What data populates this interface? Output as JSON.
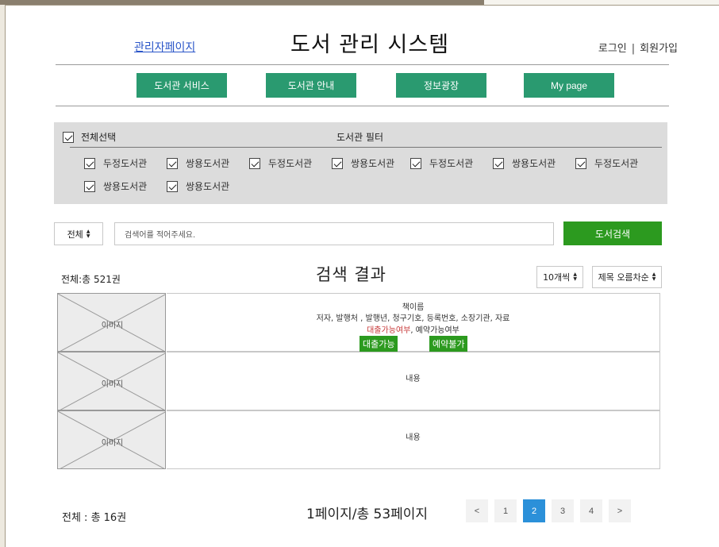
{
  "header": {
    "admin_link": "관리자페이지",
    "title": "도서 관리 시스템",
    "login": "로그인",
    "separator": "|",
    "signup": "회원가입"
  },
  "nav": [
    "도서관 서비스",
    "도서관 안내",
    "정보광장",
    "My page"
  ],
  "filter": {
    "select_all": "전체선택",
    "title": "도서관 필터",
    "libraries": [
      "두정도서관",
      "쌍용도서관",
      "두정도서관",
      "쌍용도서관",
      "두정도서관",
      "쌍용도서관",
      "두정도서관",
      "쌍용도서관",
      "쌍용도서관"
    ]
  },
  "search": {
    "category": "전체",
    "placeholder": "검색어를 적어주세요.",
    "button": "도서검색"
  },
  "results_header": {
    "total": "전체:총 521권",
    "title": "검색 결과",
    "per_page": "10개씩",
    "sort": "제목 오름차순"
  },
  "results": {
    "image_label": "이미지",
    "first": {
      "book_name": "책이름",
      "meta": "저자, 발행처 , 발행년, 청구기호, 등록번호, 소장기관, 자료",
      "availability_loan": "대출가능여부",
      "availability_sep": ", ",
      "availability_reserve": "예약가능여부",
      "loan_status": "대출가능",
      "reserve_status": "예약불가"
    },
    "content_label": "내용"
  },
  "footer": {
    "total": "전체 : 총 16권",
    "page_info": "1페이지/총 53페이지",
    "prev": "<",
    "pages": [
      "1",
      "2",
      "3",
      "4"
    ],
    "active_page": "2",
    "next": ">"
  },
  "colors": {
    "nav_green": "#2a9a70",
    "action_green": "#2c9a1f",
    "active_page_blue": "#2b90d9",
    "warning_red": "#c83a3a"
  }
}
